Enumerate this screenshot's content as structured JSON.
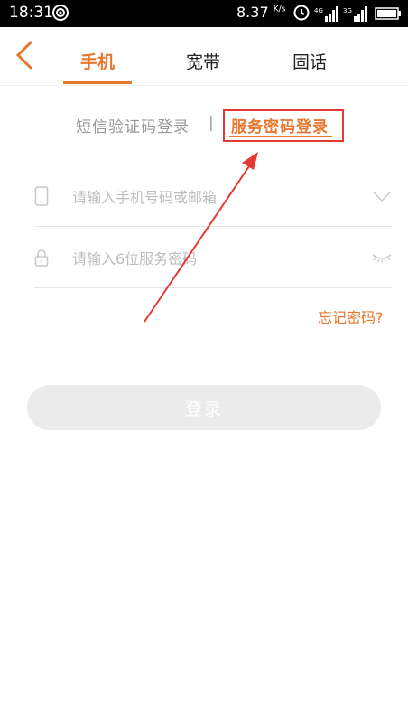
{
  "status_bar": {
    "time": "18:31",
    "speed_value": "8.37",
    "speed_unit": "K/s",
    "net1": "4G",
    "net2": "3G"
  },
  "header": {
    "tabs": [
      {
        "label": "手机",
        "active": true
      },
      {
        "label": "宽带",
        "active": false
      },
      {
        "label": "固话",
        "active": false
      }
    ]
  },
  "login_mode": {
    "sms_label": "短信验证码登录",
    "separator": "|",
    "password_label": "服务密码登录"
  },
  "form": {
    "phone_placeholder": "请输入手机号码或邮箱",
    "password_placeholder": "请输入6位服务密码",
    "forgot_label": "忘记密码?",
    "login_label": "登录"
  },
  "colors": {
    "accent": "#e8772e",
    "annotation": "#e53935",
    "button_bg": "#ebebeb"
  }
}
